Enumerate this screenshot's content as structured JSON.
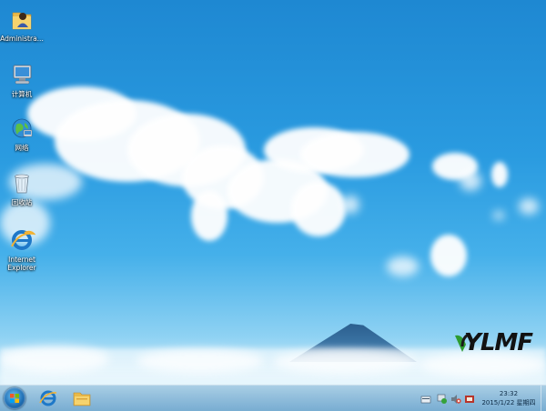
{
  "desktop": {
    "icons": [
      {
        "label": "Administra..."
      },
      {
        "label": "计算机"
      },
      {
        "label": "网络"
      },
      {
        "label": "回收站"
      },
      {
        "label": "Internet Explorer"
      }
    ],
    "logo_text": "YLMF"
  },
  "taskbar": {
    "start_icon": "windows-orb-icon",
    "pinned": [
      {
        "icon": "internet-explorer-icon"
      },
      {
        "icon": "file-explorer-icon"
      }
    ],
    "tray_icons": [
      "action-center-flag-icon",
      "network-icon",
      "volume-muted-icon",
      "language-icon"
    ],
    "clock": {
      "time": "23:32",
      "date": "2015/1/22 星期四"
    }
  }
}
